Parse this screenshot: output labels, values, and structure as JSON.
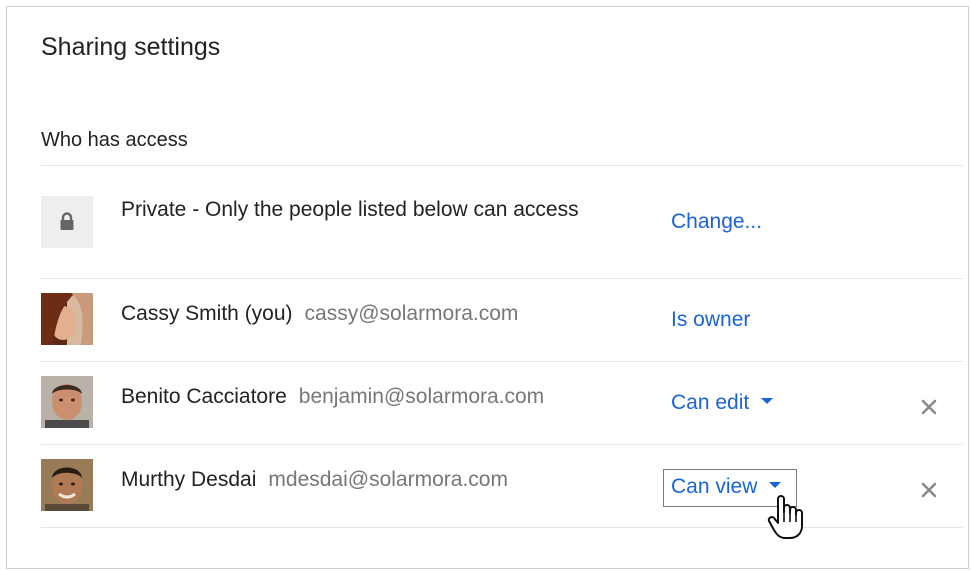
{
  "dialog": {
    "title": "Sharing settings",
    "section_label": "Who has access"
  },
  "visibility": {
    "icon": "lock-icon",
    "text": "Private - Only the people listed below can access",
    "action": "Change..."
  },
  "people": [
    {
      "name": "Cassy Smith (you)",
      "email": "cassy@solarmora.com",
      "role": "Is owner",
      "avatar": "avatar-photo"
    },
    {
      "name": "Benito Cacciatore",
      "email": "benjamin@solarmora.com",
      "role": "Can edit",
      "avatar": "avatar-photo"
    },
    {
      "name": "Murthy Desdai",
      "email": "mdesdai@solarmora.com",
      "role": "Can view",
      "avatar": "avatar-photo"
    }
  ],
  "colors": {
    "link": "#1a63d9",
    "text": "#222222",
    "muted": "#777777",
    "divider": "#e6e6e6"
  }
}
